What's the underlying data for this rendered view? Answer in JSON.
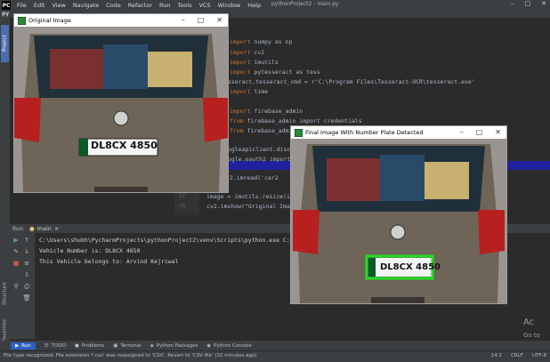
{
  "menubar": {
    "logo": "PC",
    "items": [
      "File",
      "Edit",
      "View",
      "Navigate",
      "Code",
      "Refactor",
      "Run",
      "Tools",
      "VCS",
      "Window",
      "Help"
    ],
    "title": "pythonProject2 - main.py"
  },
  "toolbar": {
    "project_abbrev": "py"
  },
  "left_tabs": {
    "project": "Project",
    "structure": "Structure",
    "favorites": "Favorites"
  },
  "editor": {
    "lines": [
      {
        "n": "",
        "pre": "",
        "kw": "",
        "rest": "numpy as np",
        "kw_first": false,
        "kwtext": "",
        "prefix": "",
        "code": "numpy as np"
      },
      {
        "n": "",
        "code": "cv2"
      },
      {
        "n": "",
        "code": "imutils"
      },
      {
        "n": "",
        "code": "pytesseract as tess"
      },
      {
        "n": "",
        "code": "tesseract.tesseract_cmd = r'C:\\Program Files\\Tesseract-OCR\\tesseract.exe'"
      },
      {
        "n": "",
        "code": "time"
      },
      {
        "n": "",
        "code": ""
      },
      {
        "n": "",
        "code": "firebase_admin"
      },
      {
        "n": "",
        "code": "firebase_admin import credentials"
      },
      {
        "n": "",
        "code": "firebase_admin import"
      },
      {
        "n": "",
        "code": ""
      },
      {
        "n": "",
        "code": "oogleapiclient.disc"
      },
      {
        "n": "",
        "code": "oogle.oauth2 import"
      },
      {
        "n": "",
        "code": ""
      },
      {
        "n": "",
        "code": "cv2.imread('car2"
      },
      {
        "n": "17",
        "code": "image = imutils.resize(im"
      },
      {
        "n": "18",
        "code": "cv2.imshow(\"Original Imag"
      }
    ]
  },
  "run_panel": {
    "label": "Run:",
    "tab": "main",
    "close": "×",
    "output": [
      "C:\\Users\\shubh\\PycharmProjects\\pythonProject2\\venv\\Scripts\\python.exe C:/",
      "Vehicle Number is: DL8CX 4850",
      "This Vehicle belongs to: Arvind Kejriwal"
    ]
  },
  "original_window": {
    "title": "Original Image",
    "plate": "DL8CX 4850"
  },
  "final_window": {
    "title": "Final Image With Number Plate Detected",
    "plate": "DL8CX 4850"
  },
  "bottom_tabs": [
    "Run",
    "TODO",
    "Problems",
    "Terminal",
    "Python Packages",
    "Python Console"
  ],
  "status": {
    "message": "File type recognized: File extension *.csv' was reassigned to 'CSV'. Revert to 'CSV file' (32 minutes ago)",
    "position": "14:1",
    "line_sep": "CRLF",
    "encoding": "UTF-8"
  },
  "watermark": {
    "line1": "Ac",
    "line2": "Go to"
  },
  "colors": {
    "accent": "#2d5fc5",
    "plate_box": "#22dd22",
    "selection": "#21219e"
  }
}
